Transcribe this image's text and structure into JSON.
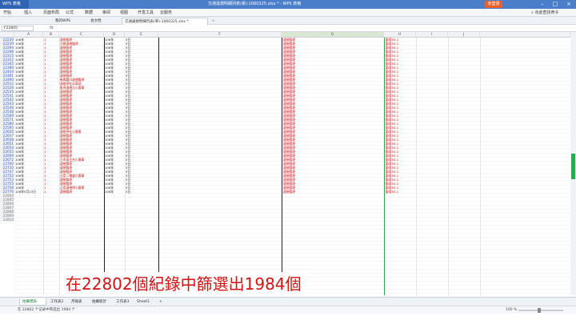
{
  "app": {
    "name": "WPS 表格",
    "window_title": "交通違規明細列表(單)-1060325.xlsx * - WPS 表格",
    "login_label": "未登录"
  },
  "menu": [
    "开始",
    "插入",
    "页面布局",
    "公式",
    "数据",
    "审阅",
    "视图",
    "开发工具",
    "云服务"
  ],
  "tabs": [
    {
      "label": "我的WPS"
    },
    {
      "label": "会文档"
    },
    {
      "label": "交通違規明細列表(單)-1060325.xlsx *"
    }
  ],
  "search_label": "点此查找命令",
  "formula": {
    "name_box": "F22845",
    "fx": "fx",
    "value": ""
  },
  "columns": [
    "A",
    "B",
    "C",
    "D",
    "E",
    "F",
    "G",
    "H",
    "I",
    "J"
  ],
  "rows": [
    {
      "n": "22230",
      "a": "106年",
      "b": "1",
      "c": "違規臨停",
      "d": "106年",
      "e": "3日",
      "f": "違規臨停",
      "g": "勸導53-1"
    },
    {
      "n": "22239",
      "a": "106年",
      "b": "1",
      "c": "大橋違規臨停",
      "d": "106年",
      "e": "3日",
      "f": "違規臨停",
      "g": "勸導53-1"
    },
    {
      "n": "22294",
      "a": "106年",
      "b": "1",
      "c": "違規臨停",
      "d": "106年",
      "e": "3日",
      "f": "違規臨停",
      "g": "勸導53-1"
    },
    {
      "n": "22298",
      "a": "106年",
      "b": "1",
      "c": "違規臨停",
      "d": "106年",
      "e": "3日",
      "f": "違規臨停",
      "g": "勸導53-1"
    },
    {
      "n": "22315",
      "a": "106年",
      "b": "1",
      "c": "違規臨停",
      "d": "106年",
      "e": "3日",
      "f": "違規臨停",
      "g": "勸導53-1"
    },
    {
      "n": "22322",
      "a": "106年",
      "b": "1",
      "c": "違規臨停",
      "d": "106年",
      "e": "3日",
      "f": "違規臨停",
      "g": "勸導53-1"
    },
    {
      "n": "22345",
      "a": "106年",
      "b": "1",
      "c": "違規臨停",
      "d": "106年",
      "e": "3日",
      "f": "違規臨停",
      "g": "勸導53-1"
    },
    {
      "n": "22389",
      "a": "106年",
      "b": "1",
      "c": "違規臨停",
      "d": "106年",
      "e": "3日",
      "f": "違規臨停",
      "g": "勸導53-1"
    },
    {
      "n": "22444",
      "a": "106年",
      "b": "1",
      "c": "違規臨停",
      "d": "106年",
      "e": "3日",
      "f": "違規臨停",
      "g": "勸導53-1"
    },
    {
      "n": "22481",
      "a": "106年",
      "b": "1",
      "c": "違規臨停",
      "d": "106年",
      "e": "3日",
      "f": "違規臨停",
      "g": "勸導53-1"
    },
    {
      "n": "22490",
      "a": "106年",
      "b": "1",
      "c": "新興路口違規臨停",
      "d": "106年",
      "e": "3日",
      "f": "違規臨停",
      "g": "勸導53-1"
    },
    {
      "n": "22512",
      "a": "106年",
      "b": "1",
      "c": "違規停在公車站",
      "d": "106年",
      "e": "3日",
      "f": "違規臨停",
      "g": "勸導53-1"
    },
    {
      "n": "22526",
      "a": "106年",
      "b": "1",
      "c": "亂停違規占小客車",
      "d": "106年",
      "e": "3日",
      "f": "違規臨停",
      "g": "勸導53-1"
    },
    {
      "n": "22535",
      "a": "106年",
      "b": "1",
      "c": "違規臨停",
      "d": "106年",
      "e": "3日",
      "f": "違規臨停",
      "g": "勸導53-1"
    },
    {
      "n": "22541",
      "a": "106年",
      "b": "1",
      "c": "違規臨停",
      "d": "106年",
      "e": "3日",
      "f": "違規臨停",
      "g": "勸導53-1"
    },
    {
      "n": "22542",
      "a": "106年",
      "b": "1",
      "c": "違規臨停",
      "d": "106年",
      "e": "3日",
      "f": "違規臨停",
      "g": "勸導53-1"
    },
    {
      "n": "22543",
      "a": "106年",
      "b": "1",
      "c": "違規臨停",
      "d": "106年",
      "e": "3日",
      "f": "違規臨停",
      "g": "勸導53-1"
    },
    {
      "n": "22546",
      "a": "106年",
      "b": "1",
      "c": "違規臨停",
      "d": "106年",
      "e": "3日",
      "f": "違規臨停",
      "g": "勸導53-1"
    },
    {
      "n": "22548",
      "a": "106年",
      "b": "1",
      "c": "違規臨停",
      "d": "106年",
      "e": "3日",
      "f": "違規臨停",
      "g": "勸導53-1"
    },
    {
      "n": "22569",
      "a": "106年",
      "b": "1",
      "c": "違規臨停",
      "d": "106年",
      "e": "3日",
      "f": "違規臨停",
      "g": "勸導53-1"
    },
    {
      "n": "22571",
      "a": "106年",
      "b": "1",
      "c": "違規臨停",
      "d": "106年",
      "e": "3日",
      "f": "違規臨停",
      "g": "勸導53-1"
    },
    {
      "n": "22580",
      "a": "106年",
      "b": "1",
      "c": "違規臨停",
      "d": "106年",
      "e": "3日",
      "f": "違規臨停",
      "g": "勸導53-1"
    },
    {
      "n": "22595",
      "a": "106年",
      "b": "1",
      "c": "違規臨停",
      "d": "106年",
      "e": "3日",
      "f": "違規臨停",
      "g": "勸導53-1"
    },
    {
      "n": "22620",
      "a": "106年",
      "b": "1",
      "c": "違規停在小客車",
      "d": "106年",
      "e": "3日",
      "f": "違規臨停",
      "g": "勸導53-1"
    },
    {
      "n": "22647",
      "a": "106年",
      "b": "1",
      "c": "違規臨停",
      "d": "106年",
      "e": "3日",
      "f": "違規臨停",
      "g": "勸導53-1"
    },
    {
      "n": "22648",
      "a": "106年",
      "b": "1",
      "c": "違規臨停",
      "d": "106年",
      "e": "3日",
      "f": "違規臨停",
      "g": "勸導53-1"
    },
    {
      "n": "22651",
      "a": "106年",
      "b": "1",
      "c": "違規臨停",
      "d": "106年",
      "e": "3日",
      "f": "違規臨停",
      "g": "勸導53-1"
    },
    {
      "n": "22654",
      "a": "106年",
      "b": "1",
      "c": "違規臨停",
      "d": "106年",
      "e": "3日",
      "f": "違規臨停",
      "g": "勸導53-1"
    },
    {
      "n": "22655",
      "a": "106年",
      "b": "1",
      "c": "違規臨停",
      "d": "106年",
      "e": "3日",
      "f": "違規臨停",
      "g": "勸導53-1"
    },
    {
      "n": "22669",
      "a": "106年",
      "b": "1",
      "c": "違規臨停",
      "d": "106年",
      "e": "3日",
      "f": "違規臨停",
      "g": "勸導53-1"
    },
    {
      "n": "22672",
      "a": "106年",
      "b": "1",
      "c": "占市區主台小客車",
      "d": "106年",
      "e": "3日",
      "f": "違規臨停",
      "g": "勸導53-1"
    },
    {
      "n": "22700",
      "a": "106年",
      "b": "1",
      "c": "違規臨停",
      "d": "106年",
      "e": "3日",
      "f": "違規臨停",
      "g": "勸導53-1"
    },
    {
      "n": "22720",
      "a": "106年",
      "b": "1",
      "c": "違規臨停",
      "d": "106年",
      "e": "3日",
      "f": "違規臨停",
      "g": "勸導53-1"
    },
    {
      "n": "22747",
      "a": "106年",
      "b": "1",
      "c": "違規臨停",
      "d": "106年",
      "e": "3日",
      "f": "違規臨停",
      "g": "勸導53-1"
    },
    {
      "n": "22752",
      "a": "106年",
      "b": "1",
      "c": "占用二線道小客車",
      "d": "106年",
      "e": "3日",
      "f": "違規臨停",
      "g": "勸導53-1"
    },
    {
      "n": "22753",
      "a": "106年",
      "b": "1",
      "c": "違規臨停",
      "d": "106年",
      "e": "3日",
      "f": "違規臨停",
      "g": "勸導53-1"
    },
    {
      "n": "22755",
      "a": "106年",
      "b": "1",
      "c": "違規臨停",
      "d": "106年",
      "e": "3日",
      "f": "違規臨停",
      "g": "勸導53-1"
    },
    {
      "n": "22758",
      "a": "106年",
      "b": "1",
      "c": "占用違規停小客車",
      "d": "106年",
      "e": "3日",
      "f": "違規臨停",
      "g": "勸導53-1"
    },
    {
      "n": "22770",
      "a": "106年5月13日",
      "b": "1",
      "c": "違規臨停",
      "d": "106年",
      "e": "3日",
      "f": "違規臨停",
      "g": "勸導53-1"
    }
  ],
  "empty_rows": [
    "22804",
    "22805",
    "22806",
    "22807",
    "22808",
    "22809",
    "22810"
  ],
  "caption": "在22802個紀錄中篩選出1984個",
  "sheets": [
    "拍攝標表",
    "工作表2",
    "月報表",
    "拍攝統計",
    "工作表3",
    "Sheet1"
  ],
  "status_text": "在 22802 个记录中筛选出 1984 个",
  "zoom": "100 %",
  "colors": {
    "accent": "#2fa84f",
    "error_text": "#d10000",
    "title_bar": "#4a7ec9",
    "caption": "#d61212"
  }
}
